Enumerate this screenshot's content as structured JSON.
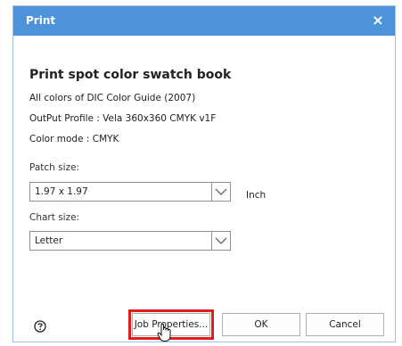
{
  "dialog": {
    "title": "Print",
    "close_symbol": "×",
    "heading": "Print spot color swatch book",
    "info": [
      "All colors of DIC Color Guide (2007)",
      "OutPut Profile : Vela 360x360 CMYK v1F",
      "Color mode : CMYK"
    ]
  },
  "patch_size": {
    "label": "Patch size:",
    "value": "1.97 x 1.97",
    "unit": "Inch"
  },
  "chart_size": {
    "label": "Chart size:",
    "value": "Letter"
  },
  "buttons": {
    "job_properties": "Job Properties...",
    "ok": "OK",
    "cancel": "Cancel"
  },
  "icons": {
    "help": "help-icon",
    "dropdown": "chevron-down-icon",
    "cursor": "hand-cursor-icon"
  },
  "colors": {
    "titlebar": "#4d93dc",
    "highlight": "#e21b1b"
  }
}
